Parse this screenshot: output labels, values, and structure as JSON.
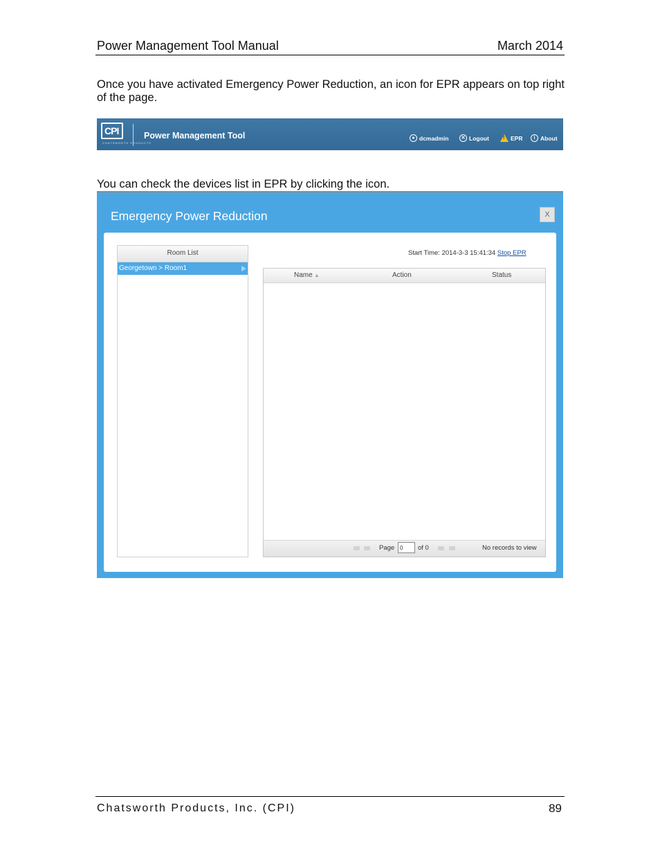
{
  "header": {
    "title": "Power Management Tool Manual",
    "date": "March 2014"
  },
  "paragraphs": {
    "intro": "Once you have activated Emergency Power Reduction, an icon for EPR appears on top right of the page.",
    "check": "You can check the devices list in EPR by clicking the icon."
  },
  "banner": {
    "logo_text": "CPI",
    "logo_sub": "CHATSWORTH PRODUCTS",
    "title": "Power Management Tool",
    "user": "dcmadmin",
    "logout": "Logout",
    "epr": "EPR",
    "about": "About",
    "colors": {
      "bar": "#3a73a0",
      "warning": "#f2c21c"
    }
  },
  "dialog": {
    "title": "Emergency Power Reduction",
    "close": "X",
    "room_list": {
      "header": "Room List",
      "items": [
        "Georgetown > Room1"
      ]
    },
    "start_time_label": "Start Time:",
    "start_time": "2014-3-3 15:41:34",
    "stop_link": "Stop EPR",
    "grid": {
      "columns": [
        "Name",
        "Action",
        "Status"
      ],
      "sort_indicator": "▲",
      "page_label": "Page",
      "page_value": "0",
      "of_label": "of 0",
      "records": "No records to view"
    },
    "colors": {
      "frame": "#4aa6e3",
      "selected_row": "#4ea9e6"
    }
  },
  "footer": {
    "company": "Chatsworth Products, Inc. (CPI)",
    "page_number": "89"
  }
}
